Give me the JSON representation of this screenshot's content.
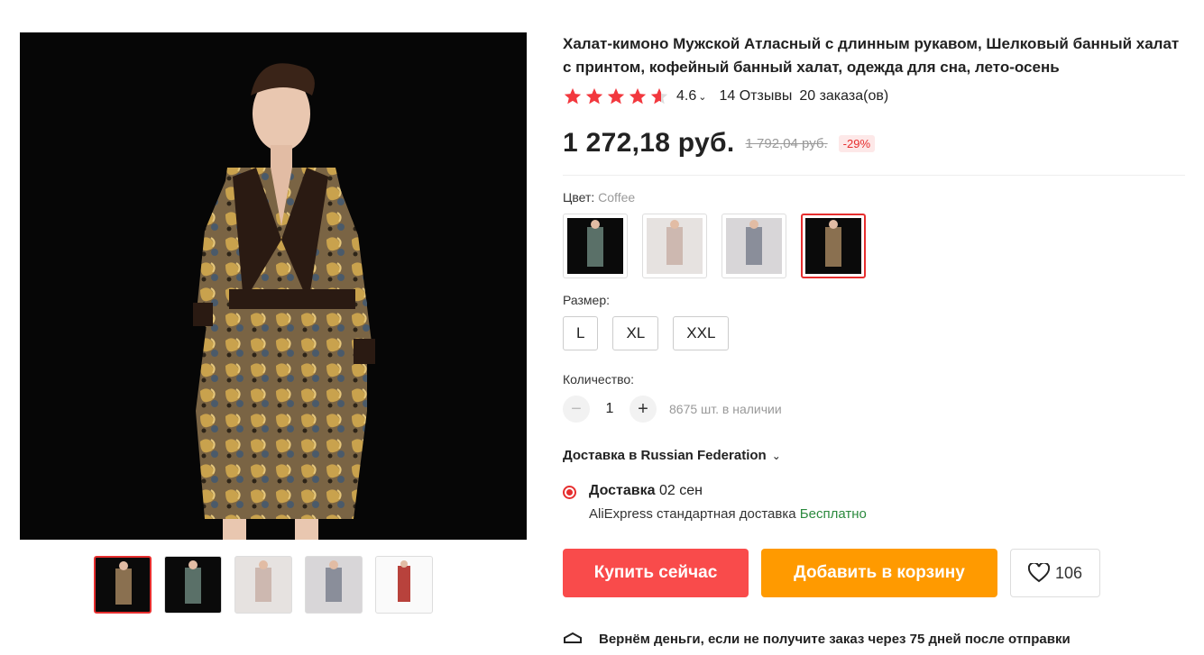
{
  "product": {
    "title": "Халат-кимоно Мужской Атласный с длинным рукавом, Шелковый банный халат с принтом, кофейный банный халат, одежда для сна, лето-осень",
    "rating": "4.6",
    "reviews": "14 Отзывы",
    "orders": "20 заказа(ов)",
    "price": "1 272,18 руб.",
    "old_price": "1 792,04 руб.",
    "discount": "-29%"
  },
  "color": {
    "label": "Цвет:",
    "selected": "Coffee"
  },
  "size": {
    "label": "Размер:",
    "options": [
      "L",
      "XL",
      "XXL"
    ]
  },
  "quantity": {
    "label": "Количество:",
    "minus": "−",
    "value": "1",
    "plus": "+",
    "stock": "8675 шт. в наличии"
  },
  "shipping": {
    "to": "Доставка в Russian Federation",
    "method_title": "Доставка",
    "method_date": "02 сен",
    "carrier": "AliExpress стандартная доставка",
    "price": "Бесплатно"
  },
  "actions": {
    "buy": "Купить сейчас",
    "cart": "Добавить в корзину",
    "wishlist_count": "106"
  },
  "guarantee": {
    "text": "Вернём деньги, если не получите заказ через 75 дней после отправки"
  },
  "colors": {
    "accent": "#e62e2e",
    "buy": "#f94b4b",
    "cart": "#ff9a00",
    "free": "#2b8a3e"
  }
}
